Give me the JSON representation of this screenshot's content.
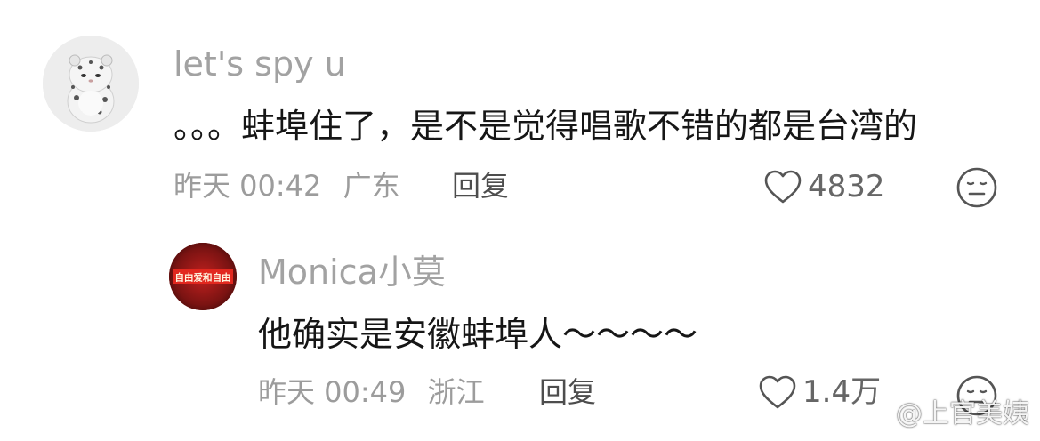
{
  "comments": [
    {
      "username": "let's spy u",
      "content": "。。。蚌埠住了，是不是觉得唱歌不错的都是台湾的",
      "time": "昨天 00:42",
      "location": "广东",
      "reply_label": "回复",
      "likes": "4832",
      "avatar_icon": "snow-leopard-avatar"
    },
    {
      "username": "Monica小莫",
      "content": "他确实是安徽蚌埠人～～～～",
      "time": "昨天 00:49",
      "location": "浙江",
      "reply_label": "回复",
      "likes": "1.4万",
      "avatar_icon": "red-banner-avatar",
      "avatar_text": "自由爱和自由"
    }
  ],
  "watermark": {
    "text": "@上官美姨",
    "icon": "weibo-logo-icon"
  },
  "colors": {
    "username": "#a2a2a2",
    "content": "#161616",
    "meta": "#9c9c9c",
    "reply": "#4d4d4d",
    "icon": "#555555"
  }
}
